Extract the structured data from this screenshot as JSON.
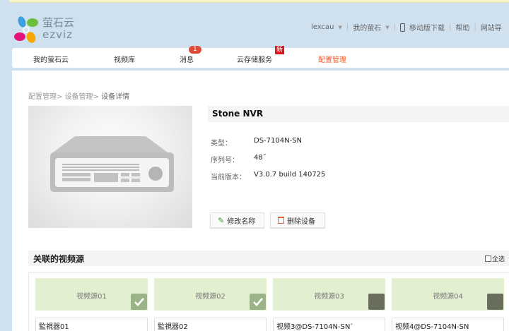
{
  "brand": {
    "name_cn": "萤石云",
    "name_en": "ezviz"
  },
  "topnav": {
    "user": "lexcau",
    "my": "我的萤石",
    "mobile": "移动版下载",
    "help": "帮助",
    "site": "网站导"
  },
  "nav": {
    "items": [
      {
        "label": "我的萤石云"
      },
      {
        "label": "视频库"
      },
      {
        "label": "消息",
        "badge": "1"
      },
      {
        "label": "云存储服务",
        "badge": "新"
      },
      {
        "label": "配置管理",
        "active": true
      }
    ],
    "accent": "#f05a28"
  },
  "breadcrumb": [
    "配置管理",
    "设备管理",
    "设备详情"
  ],
  "device": {
    "name": "Stone NVR",
    "type_label": "类型：",
    "type": "DS-7104N-SN",
    "serial_label": "序列号：",
    "serial": "48˘",
    "version_label": "当前版本：",
    "version": "V3.0.7 build 140725"
  },
  "buttons": {
    "rename": "修改名称",
    "delete": "删除设备"
  },
  "sources": {
    "title": "关联的视频源",
    "select_all": "全选",
    "items": [
      {
        "label": "视频源01",
        "name": "監視器01",
        "checked": true
      },
      {
        "label": "视频源02",
        "name": "監視器02",
        "checked": true
      },
      {
        "label": "视频源03",
        "name": "视频3@DS-7104N-SN`",
        "checked": false
      },
      {
        "label": "视频源04",
        "name": "视频4@DS-7104N-SN",
        "checked": false
      }
    ]
  }
}
